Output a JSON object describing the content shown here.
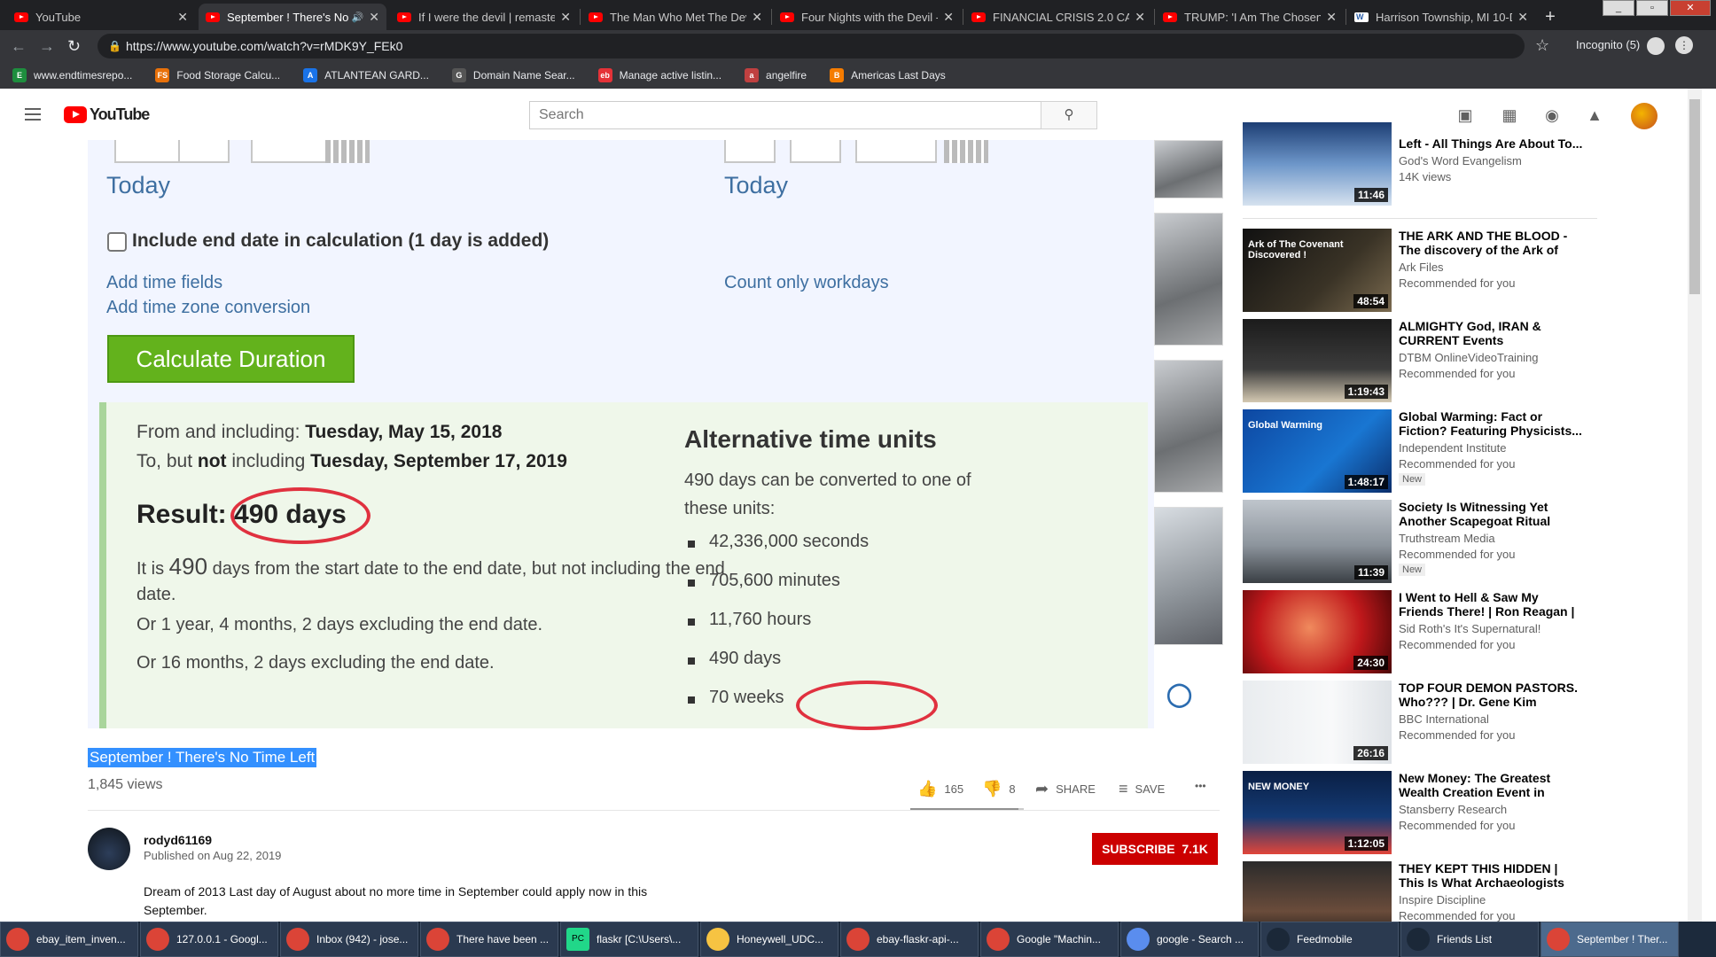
{
  "browser": {
    "tabs": [
      {
        "title": "YouTube",
        "icon": "youtube"
      },
      {
        "title": "September ! There's No",
        "icon": "youtube",
        "active": true
      },
      {
        "title": "If I were the devil | remaster",
        "icon": "youtube"
      },
      {
        "title": "The Man Who Met The Devi",
        "icon": "youtube"
      },
      {
        "title": "Four Nights with the Devil -",
        "icon": "youtube"
      },
      {
        "title": "FINANCIAL CRISIS 2.0 CAN'T",
        "icon": "youtube"
      },
      {
        "title": "TRUMP: 'I Am The Chosen C",
        "icon": "youtube"
      },
      {
        "title": "Harrison Township, MI 10-D",
        "icon": "wikipedia"
      }
    ],
    "url": "https://www.youtube.com/watch?v=rMDK9Y_FEk0",
    "incognito_label": "Incognito (5)",
    "bookmarks": [
      {
        "label": "www.endtimesrepo...",
        "color": "#1e8e3e",
        "glyph": "E"
      },
      {
        "label": "Food Storage Calcu...",
        "color": "#e8710a",
        "glyph": "FS"
      },
      {
        "label": "ATLANTEAN GARD...",
        "color": "#1a73e8",
        "glyph": "A"
      },
      {
        "label": "Domain Name Sear...",
        "color": "#555555",
        "glyph": "G"
      },
      {
        "label": "Manage active listin...",
        "color": "#e53238",
        "glyph": "eb"
      },
      {
        "label": "angelfire",
        "color": "#c04040",
        "glyph": "a"
      },
      {
        "label": "Americas Last Days",
        "color": "#f57c00",
        "glyph": "B"
      }
    ]
  },
  "youtube": {
    "logo_text": "YouTube",
    "search_placeholder": "Search"
  },
  "video_frame": {
    "today_left": "Today",
    "today_right": "Today",
    "checkbox_label": "Include end date in calculation (1 day is added)",
    "link_time_fields": "Add time fields",
    "link_time_zone": "Add time zone conversion",
    "link_workdays": "Count only workdays",
    "calculate_button": "Calculate Duration",
    "from_prefix": "From and including: ",
    "from_date": "Tuesday, May 15, 2018",
    "to_prefix": "To, but ",
    "to_not": "not",
    "to_mid": " including ",
    "to_date": "Tuesday, September 17, 2019",
    "result_label": "Result: ",
    "result_value": "490 days",
    "it_is_1": "It is ",
    "it_is_num": "490",
    "it_is_2": " days from the start date to the end date, but not including the end",
    "it_is_3": "date.",
    "or_years": "Or 1 year, 4 months, 2 days excluding the end date.",
    "or_months": "Or 16 months, 2 days excluding the end date.",
    "alt_title": "Alternative time units",
    "alt_intro_1": "490 days can be converted to one of",
    "alt_intro_2": "these units:",
    "alt_units": [
      "42,336,000 seconds",
      "705,600 minutes",
      "11,760 hours",
      "490 days",
      "70 weeks"
    ]
  },
  "video": {
    "title": "September ! There's No Time Left",
    "views": "1,845 views",
    "likes": "165",
    "dislikes": "8",
    "like_ratio": 0.95,
    "share_label": "SHARE",
    "save_label": "SAVE",
    "more_label": "•••",
    "channel": "rodyd61169",
    "published": "Published on Aug 22, 2019",
    "subscribe_label": "SUBSCRIBE",
    "subscriber_count": "7.1K",
    "description_1": "Dream of 2013 Last day of August about no more time in September could apply now in this",
    "description_2": "September."
  },
  "recommendations": [
    {
      "title": "Left - All Things Are About To...",
      "channel": "God's Word Evangelism",
      "meta": "14K views",
      "duration": "11:46",
      "thumb": "linear-gradient(180deg,#1d3e74,#6d96c9 50%,#d6e2ef)"
    },
    {
      "title": "THE ARK AND THE BLOOD - The discovery of the Ark of the...",
      "channel": "Ark Files",
      "meta": "Recommended for you",
      "duration": "48:54",
      "thumb": "linear-gradient(135deg,#111,#3a3326 60%,#7a6a4f)",
      "overlay": "Ark of The Covenant Discovered !"
    },
    {
      "title": "ALMIGHTY God, IRAN & CURRENT Events",
      "channel": "DTBM OnlineVideoTraining",
      "meta": "Recommended for you",
      "duration": "1:19:43",
      "thumb": "linear-gradient(180deg,#1b1b1b,#3c3c3c 60%,#d4c9b2)"
    },
    {
      "title": "Global Warming: Fact or Fiction? Featuring Physicists...",
      "channel": "Independent Institute",
      "meta": "Recommended for you",
      "badge": "New",
      "duration": "1:48:17",
      "thumb": "linear-gradient(135deg,#0d47a1,#1976d2 60%,#0b2e6b)",
      "overlay": "Global Warming"
    },
    {
      "title": "Society Is Witnessing Yet Another Scapegoat Ritual",
      "channel": "Truthstream Media",
      "meta": "Recommended for you",
      "badge": "New",
      "duration": "11:39",
      "thumb": "linear-gradient(180deg,#bfc5cc,#8c949c 55%,#3a3f44)"
    },
    {
      "title": "I Went to Hell & Saw My Friends There! | Ron Reagan | It's...",
      "channel": "Sid Roth's It's Supernatural!",
      "meta": "Recommended for you",
      "duration": "24:30",
      "thumb": "radial-gradient(circle at 45% 45%,#f08a5d,#c0181b 55%,#4b0607)"
    },
    {
      "title": "TOP FOUR DEMON PASTORS. Who??? | Dr. Gene Kim",
      "channel": "BBC International",
      "meta": "Recommended for you",
      "duration": "26:16",
      "thumb": "linear-gradient(90deg,#e9ecef,#f8f9fa 60%,#dee2e6)"
    },
    {
      "title": "New Money: The Greatest Wealth Creation Event in Histo...",
      "channel": "Stansberry Research",
      "meta": "Recommended for you",
      "duration": "1:12:05",
      "thumb": "linear-gradient(180deg,#0a1f44,#143a74 55%,#e0453a)",
      "overlay": "NEW MONEY"
    },
    {
      "title": "THEY KEPT THIS HIDDEN | This Is What Archaeologists Don't...",
      "channel": "Inspire Discipline",
      "meta": "Recommended for you",
      "duration": "",
      "thumb": "linear-gradient(180deg,#2b2b2b,#6a4c3b 60%,#111)"
    }
  ],
  "taskbar": [
    {
      "label": "ebay_item_inven...",
      "icon": "chrome"
    },
    {
      "label": "127.0.0.1 - Googl...",
      "icon": "chrome"
    },
    {
      "label": "Inbox (942) - jose...",
      "icon": "chrome"
    },
    {
      "label": "There have been ...",
      "icon": "chrome"
    },
    {
      "label": "flaskr [C:\\Users\\...",
      "icon": "pycharm"
    },
    {
      "label": "Honeywell_UDC...",
      "icon": "folder"
    },
    {
      "label": "ebay-flaskr-api-...",
      "icon": "chrome"
    },
    {
      "label": "Google \"Machin...",
      "icon": "chrome"
    },
    {
      "label": "google - Search ...",
      "icon": "search"
    },
    {
      "label": "Feedmobile",
      "icon": "steam"
    },
    {
      "label": "Friends List",
      "icon": "steam"
    },
    {
      "label": "September ! Ther...",
      "icon": "chrome",
      "active": true
    }
  ]
}
